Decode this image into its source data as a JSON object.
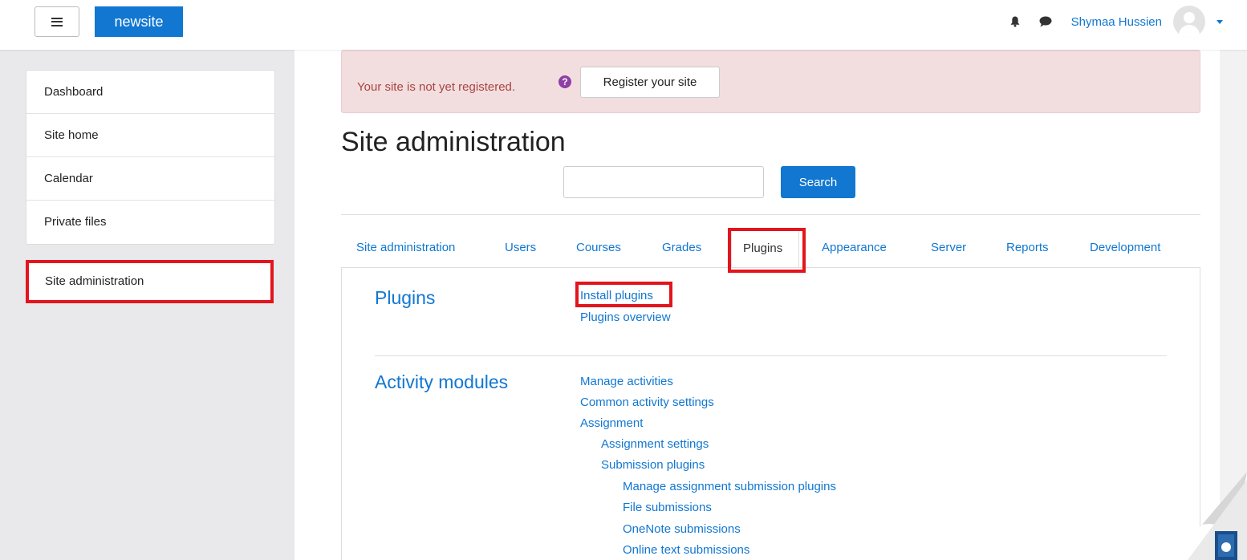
{
  "header": {
    "brand": "newsite",
    "user_name": "Shymaa Hussien"
  },
  "sidebar": {
    "items": [
      "Dashboard",
      "Site home",
      "Calendar",
      "Private files"
    ],
    "site_admin": "Site administration"
  },
  "alert": {
    "message": "Your site is not yet registered.",
    "button": "Register your site"
  },
  "page": {
    "title": "Site administration",
    "search_button": "Search"
  },
  "tabs": [
    "Site administration",
    "Users",
    "Courses",
    "Grades",
    "Plugins",
    "Appearance",
    "Server",
    "Reports",
    "Development"
  ],
  "sections": {
    "plugins": {
      "title": "Plugins",
      "links": [
        "Install plugins",
        "Plugins overview"
      ]
    },
    "activity_modules": {
      "title": "Activity modules",
      "links": [
        "Manage activities",
        "Common activity settings",
        "Assignment",
        "Assignment settings",
        "Submission plugins",
        "Manage assignment submission plugins",
        "File submissions",
        "OneNote submissions",
        "Online text submissions"
      ]
    }
  },
  "colors": {
    "accent": "#1177d1",
    "highlight": "#e2151d",
    "alert_bg": "#f2dede"
  }
}
